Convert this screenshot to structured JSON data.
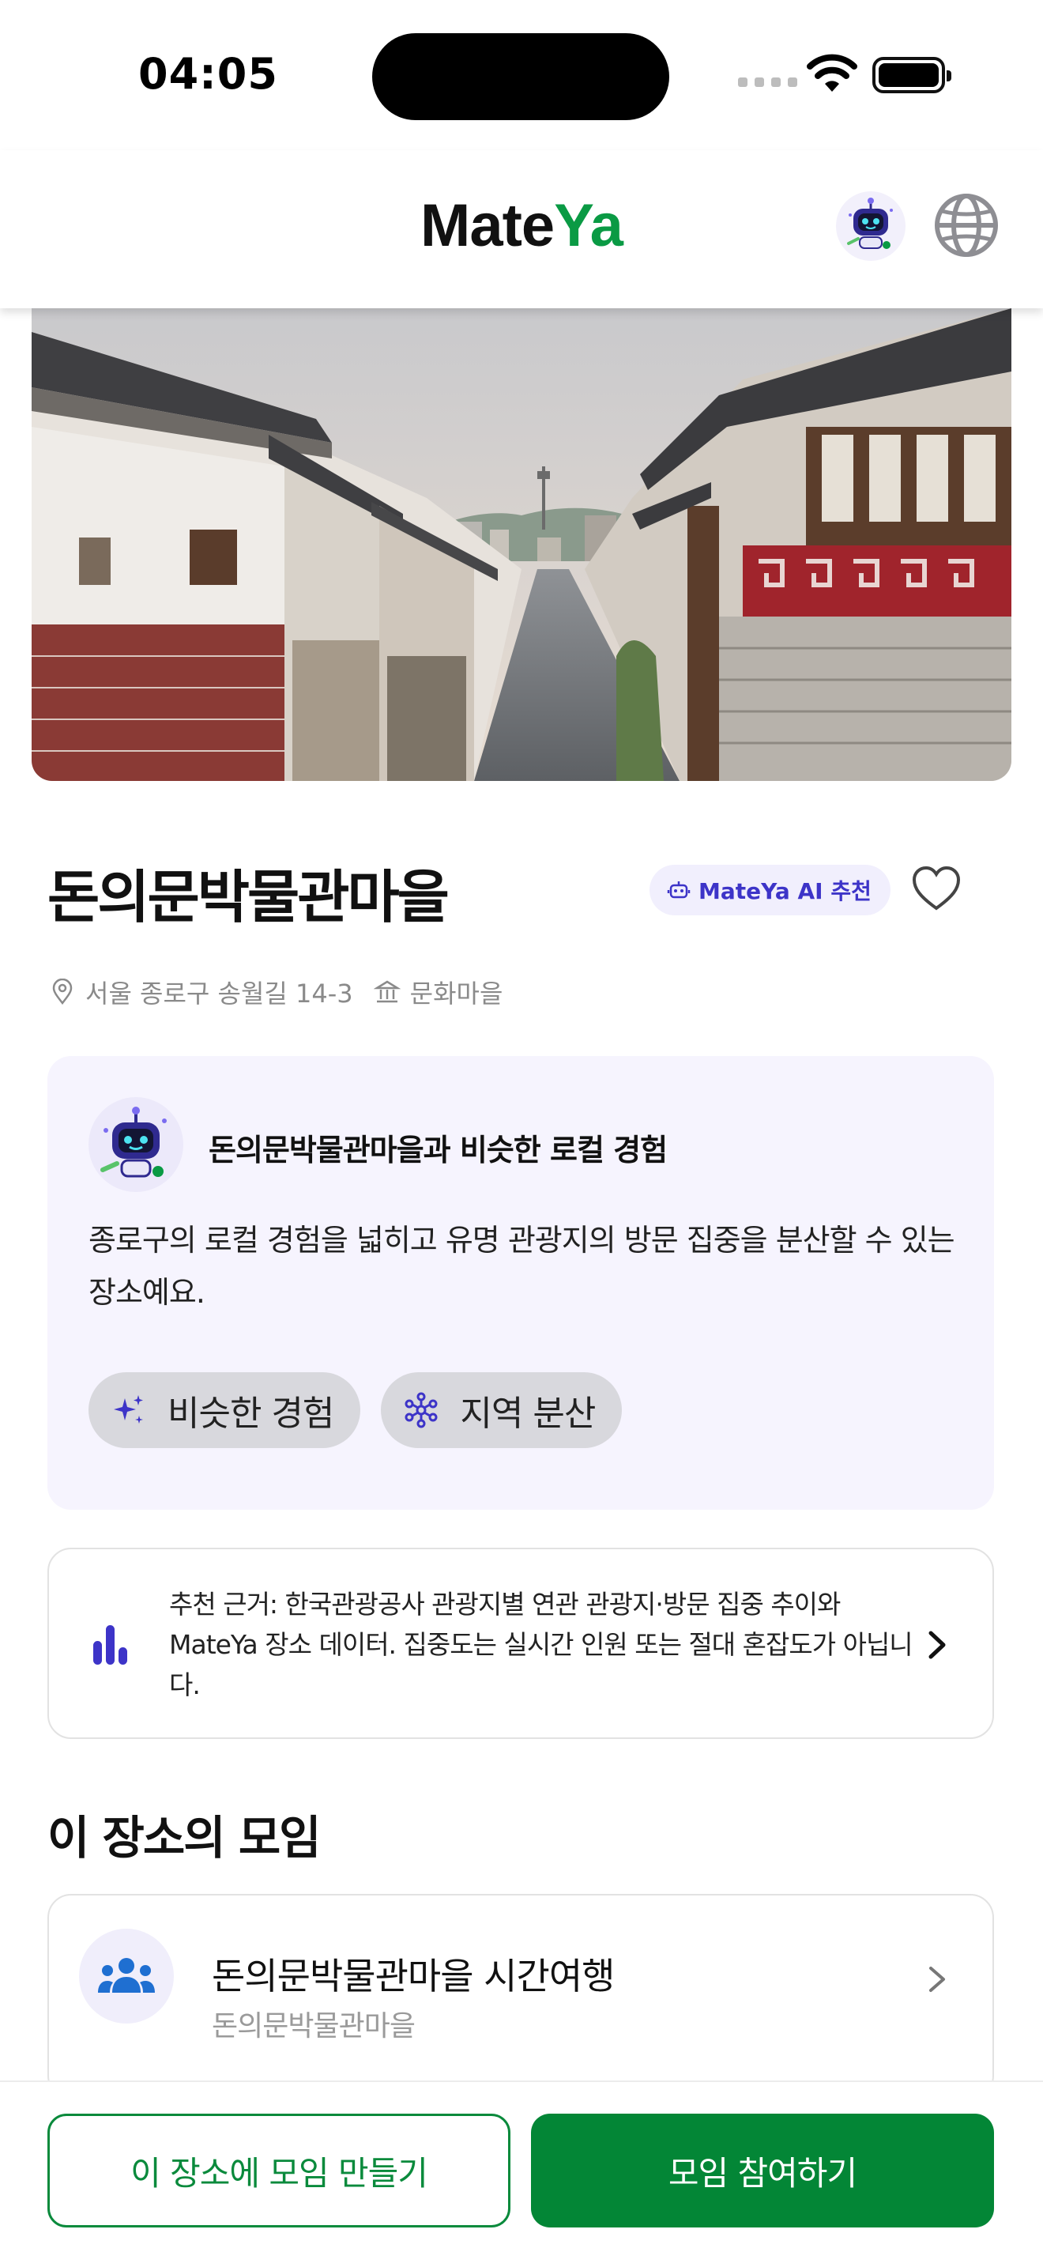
{
  "status_bar": {
    "time": "04:05"
  },
  "header": {
    "logo_part1": "Mate",
    "logo_part2": "Ya",
    "brand_color": "#0a9a44",
    "icons": [
      "mateya-bot-icon",
      "globe-icon"
    ]
  },
  "place": {
    "name": "돈의문박물관마을",
    "ai_badge": "MateYa AI 추천",
    "address": "서울 종로구 송월길 14-3",
    "category": "문화마을"
  },
  "ai_card": {
    "title": "돈의문박물관마을과 비슷한 로컬 경험",
    "body": "종로구의 로컬 경험을 넓히고 유명 관광지의 방문 집중을 분산할 수 있는 장소예요.",
    "chips": [
      {
        "label": "비슷한 경험",
        "icon": "sparkle-icon"
      },
      {
        "label": "지역 분산",
        "icon": "network-icon"
      }
    ]
  },
  "reason": {
    "text": "추천 근거: 한국관광공사 관광지별 연관 관광지·방문 집중 추이와 MateYa 장소 데이터. 집중도는 실시간 인원 또는 절대 혼잡도가 아닙니다."
  },
  "meetups": {
    "section_title": "이 장소의 모임",
    "items": [
      {
        "title": "돈의문박물관마을 시간여행",
        "subtitle": "돈의문박물관마을"
      }
    ]
  },
  "actions": {
    "create_label": "이 장소에 모임 만들기",
    "join_label": "모임 참여하기"
  },
  "colors": {
    "accent_purple": "#3d34c8",
    "primary_green": "#038636"
  }
}
